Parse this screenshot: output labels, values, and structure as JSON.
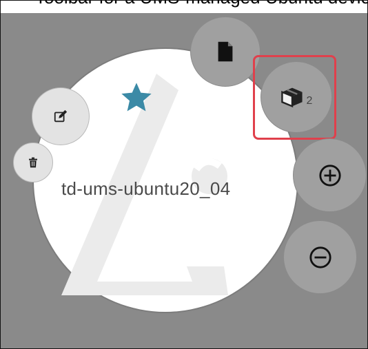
{
  "header": {
    "text": "Toolbar for a UMS-managed Ubuntu device"
  },
  "device": {
    "name": "td-ums-ubuntu20_04",
    "favorite": true
  },
  "actions": {
    "edit": {
      "icon": "pencil-square-icon"
    },
    "delete": {
      "icon": "trash-icon"
    },
    "document": {
      "icon": "document-icon"
    },
    "apps": {
      "icon": "package-icon",
      "count": "2"
    },
    "add": {
      "icon": "plus-circle-icon"
    },
    "remove": {
      "icon": "minus-circle-icon"
    }
  },
  "colors": {
    "star": "#3b8aa6",
    "highlight": "#e0404c",
    "button_dark": "#a0a0a0",
    "button_light": "#e3e3e3"
  }
}
